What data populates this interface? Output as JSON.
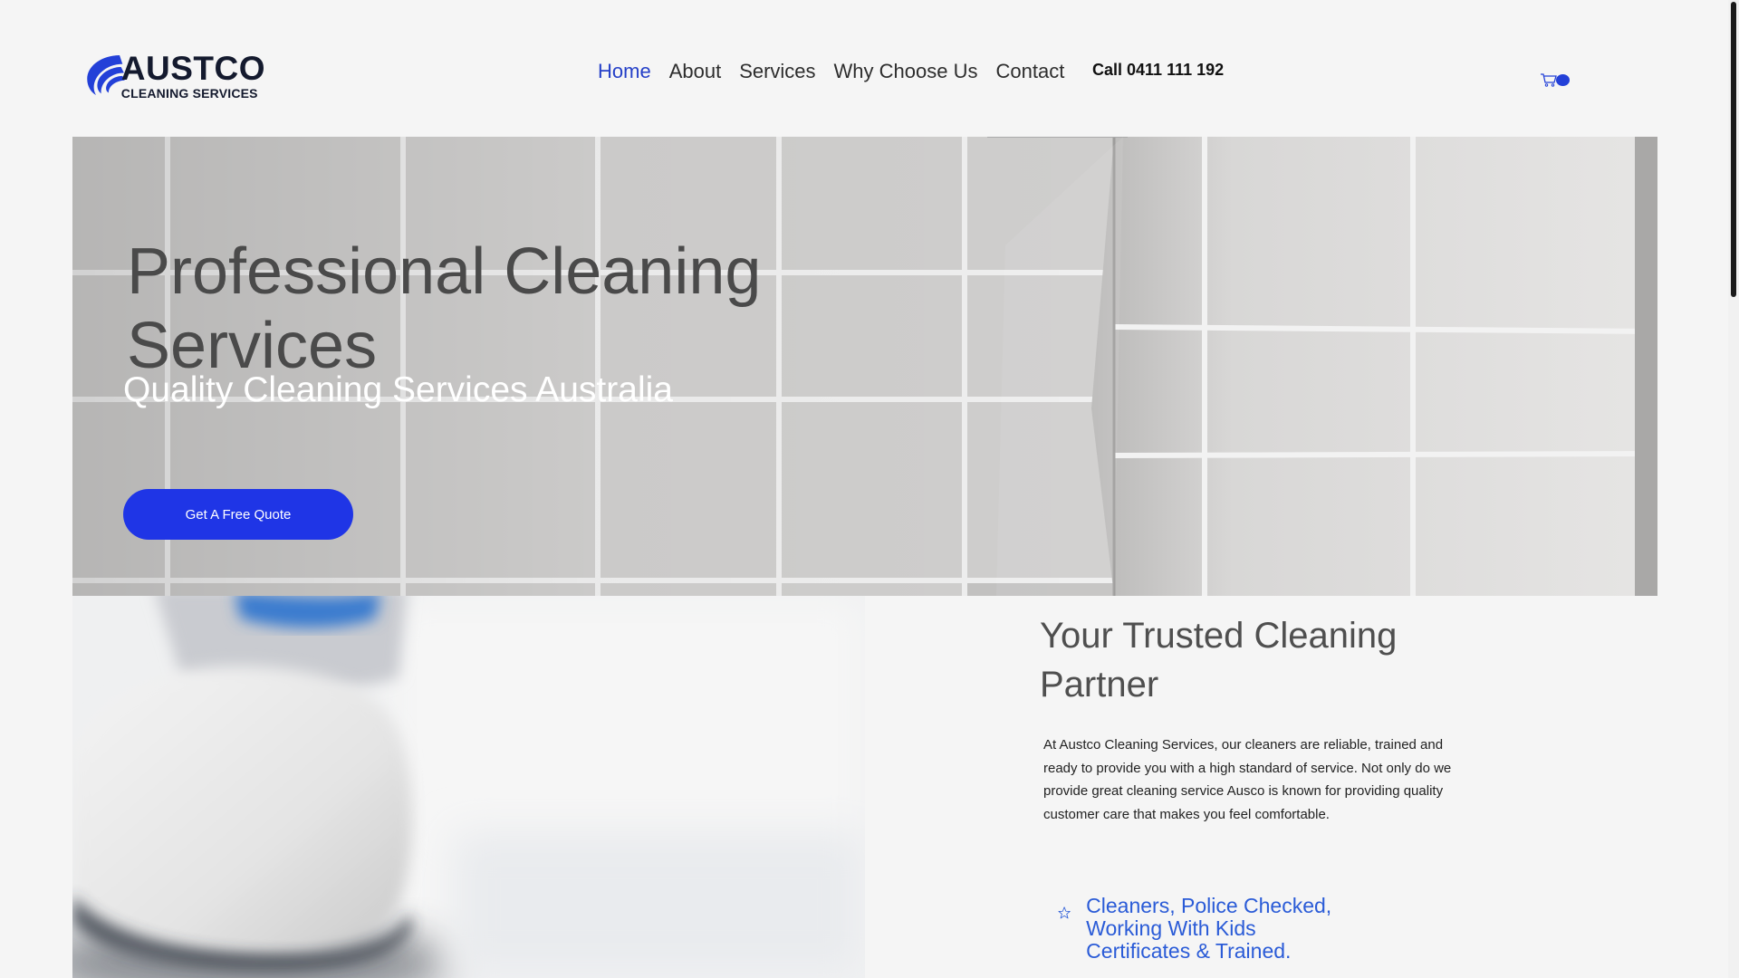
{
  "brand": {
    "name": "AUSTCO",
    "tagline": "CLEANING SERVICES",
    "accent_color": "#1f35e6",
    "logo_icon": "swoosh-logo-icon"
  },
  "header": {
    "nav_items": [
      {
        "label": "Home",
        "active": true
      },
      {
        "label": "About",
        "active": false
      },
      {
        "label": "Services",
        "active": false
      },
      {
        "label": "Why Choose Us",
        "active": false
      },
      {
        "label": "Contact",
        "active": false
      }
    ],
    "phone_text": "Call 0411 111 192",
    "cart": {
      "icon": "cart-icon",
      "count": "0"
    }
  },
  "hero": {
    "title": "Professional Cleaning Services",
    "subtitle": "Quality Cleaning Services Australia",
    "cta_label": "Get A Free Quote"
  },
  "about": {
    "title": "Your Trusted Cleaning Partner",
    "body": "At Austco Cleaning Services, our cleaners are reliable, trained and ready to provide you with a high standard of service. Not only do we provide great cleaning service Ausco is known for providing quality customer care that makes you feel comfortable.",
    "feature": {
      "icon": "star-outline-icon",
      "text": "Cleaners, Police Checked, Working With Kids Certificates & Trained."
    }
  }
}
